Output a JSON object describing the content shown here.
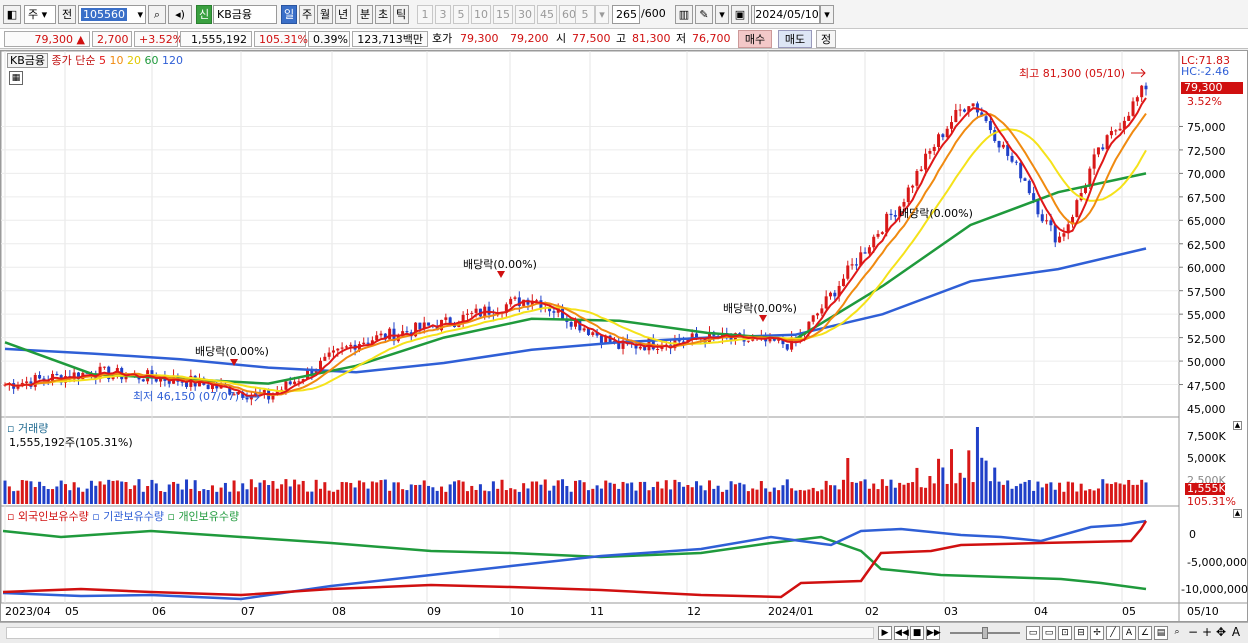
{
  "toolbar": {
    "market": "주",
    "prev": "전",
    "code": "105560",
    "tag": "신",
    "name": "KB금융",
    "periods": [
      "일",
      "주",
      "월",
      "년",
      "분",
      "초",
      "틱"
    ],
    "minutes": [
      "1",
      "3",
      "5",
      "10",
      "15",
      "30",
      "45",
      "60"
    ],
    "n_value": "5",
    "count": "265",
    "count_total": "/600",
    "date": "2024/05/10"
  },
  "quote": {
    "price": "79,300",
    "arrow": "▲",
    "change": "2,700",
    "change_pct": "+3.52%",
    "volume": "1,555,192",
    "vol_ratio": "105.31%",
    "turnover": "0.39%",
    "amount": "123,713백만",
    "hoga_label": "호가",
    "ask": "79,300",
    "bid": "79,200",
    "open_label": "시",
    "open": "77,500",
    "high_label": "고",
    "high": "81,300",
    "low_label": "저",
    "low": "76,700",
    "buy": "매수",
    "sell": "매도",
    "correct": "정"
  },
  "legend": {
    "name": "KB금융",
    "price_label": "종가 단순",
    "ma": [
      "5",
      "10",
      "20",
      "60",
      "120"
    ],
    "colors": [
      "#e01818",
      "#f08a10",
      "#f5e21a",
      "#1f9a3c",
      "#2f5fd6"
    ]
  },
  "right_info": {
    "lc": "LC:71.83",
    "hc": "HC:-2.46",
    "cur_price": "79,300",
    "cur_pct": "3.52%"
  },
  "annotations": {
    "high": "최고 81,300 (05/10)",
    "low": "최저 46,150 (07/07)",
    "div": "배당락(0.00%)"
  },
  "price_axis": [
    "75,000",
    "72,500",
    "70,000",
    "67,500",
    "65,000",
    "62,500",
    "60,000",
    "57,500",
    "55,000",
    "52,500",
    "50,000",
    "47,500",
    "45,000"
  ],
  "volume_panel": {
    "title": "거래량",
    "sub": "1,555,192주(105.31%)",
    "axis": [
      "7,500K",
      "5,000K",
      "2,500K"
    ],
    "cur": "1,555K",
    "cur_pct": "105.31%"
  },
  "holdings_panel": {
    "series": [
      "외국인보유수량",
      "기관보유수량",
      "개인보유수량"
    ],
    "colors": [
      "#e01818",
      "#2f5fd6",
      "#1f9a3c"
    ],
    "axis": [
      "0",
      "-5,000,000",
      "-10,000,000"
    ]
  },
  "x_axis": [
    "2023/04",
    "05",
    "06",
    "07",
    "08",
    "09",
    "10",
    "11",
    "12",
    "2024/01",
    "02",
    "03",
    "04",
    "05"
  ],
  "x_right": "05/10",
  "chart_data": {
    "type": "line",
    "title": "KB금융",
    "price_ylim": [
      45000,
      80000
    ],
    "close": [
      {
        "x": "2023/04",
        "y": 47500
      },
      {
        "x": "05",
        "y": 48800
      },
      {
        "x": "06",
        "y": 48000
      },
      {
        "x": "07",
        "y": 46150
      },
      {
        "x": "08",
        "y": 52000
      },
      {
        "x": "09",
        "y": 54000
      },
      {
        "x": "10",
        "y": 56800
      },
      {
        "x": "11",
        "y": 51500
      },
      {
        "x": "12",
        "y": 52500
      },
      {
        "x": "2024/01",
        "y": 51800
      },
      {
        "x": "02",
        "y": 64500
      },
      {
        "x": "03",
        "y": 75500
      },
      {
        "x": "04",
        "y": 66000
      },
      {
        "x": "05",
        "y": 79300
      }
    ],
    "ma60": [
      52000,
      48600,
      48100,
      47600,
      49500,
      52500,
      54500,
      54300,
      53000,
      52300,
      58000,
      64500,
      68000,
      70000
    ],
    "ma120": [
      51300,
      50800,
      50200,
      49300,
      48800,
      49800,
      51200,
      52000,
      52500,
      52800,
      55000,
      58500,
      59800,
      62000
    ]
  }
}
